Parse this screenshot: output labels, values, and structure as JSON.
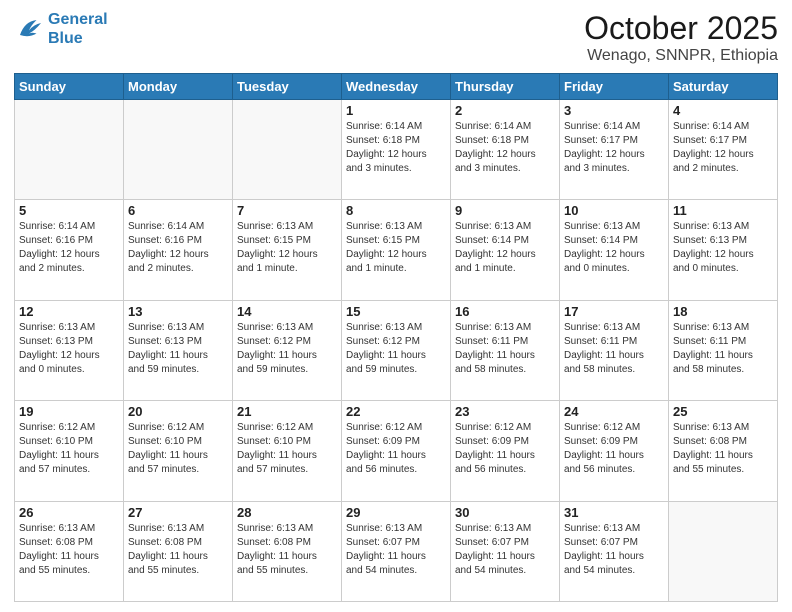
{
  "header": {
    "logo_line1": "General",
    "logo_line2": "Blue",
    "title": "October 2025",
    "subtitle": "Wenago, SNNPR, Ethiopia"
  },
  "days_of_week": [
    "Sunday",
    "Monday",
    "Tuesday",
    "Wednesday",
    "Thursday",
    "Friday",
    "Saturday"
  ],
  "weeks": [
    [
      {
        "day": "",
        "info": ""
      },
      {
        "day": "",
        "info": ""
      },
      {
        "day": "",
        "info": ""
      },
      {
        "day": "1",
        "info": "Sunrise: 6:14 AM\nSunset: 6:18 PM\nDaylight: 12 hours\nand 3 minutes."
      },
      {
        "day": "2",
        "info": "Sunrise: 6:14 AM\nSunset: 6:18 PM\nDaylight: 12 hours\nand 3 minutes."
      },
      {
        "day": "3",
        "info": "Sunrise: 6:14 AM\nSunset: 6:17 PM\nDaylight: 12 hours\nand 3 minutes."
      },
      {
        "day": "4",
        "info": "Sunrise: 6:14 AM\nSunset: 6:17 PM\nDaylight: 12 hours\nand 2 minutes."
      }
    ],
    [
      {
        "day": "5",
        "info": "Sunrise: 6:14 AM\nSunset: 6:16 PM\nDaylight: 12 hours\nand 2 minutes."
      },
      {
        "day": "6",
        "info": "Sunrise: 6:14 AM\nSunset: 6:16 PM\nDaylight: 12 hours\nand 2 minutes."
      },
      {
        "day": "7",
        "info": "Sunrise: 6:13 AM\nSunset: 6:15 PM\nDaylight: 12 hours\nand 1 minute."
      },
      {
        "day": "8",
        "info": "Sunrise: 6:13 AM\nSunset: 6:15 PM\nDaylight: 12 hours\nand 1 minute."
      },
      {
        "day": "9",
        "info": "Sunrise: 6:13 AM\nSunset: 6:14 PM\nDaylight: 12 hours\nand 1 minute."
      },
      {
        "day": "10",
        "info": "Sunrise: 6:13 AM\nSunset: 6:14 PM\nDaylight: 12 hours\nand 0 minutes."
      },
      {
        "day": "11",
        "info": "Sunrise: 6:13 AM\nSunset: 6:13 PM\nDaylight: 12 hours\nand 0 minutes."
      }
    ],
    [
      {
        "day": "12",
        "info": "Sunrise: 6:13 AM\nSunset: 6:13 PM\nDaylight: 12 hours\nand 0 minutes."
      },
      {
        "day": "13",
        "info": "Sunrise: 6:13 AM\nSunset: 6:13 PM\nDaylight: 11 hours\nand 59 minutes."
      },
      {
        "day": "14",
        "info": "Sunrise: 6:13 AM\nSunset: 6:12 PM\nDaylight: 11 hours\nand 59 minutes."
      },
      {
        "day": "15",
        "info": "Sunrise: 6:13 AM\nSunset: 6:12 PM\nDaylight: 11 hours\nand 59 minutes."
      },
      {
        "day": "16",
        "info": "Sunrise: 6:13 AM\nSunset: 6:11 PM\nDaylight: 11 hours\nand 58 minutes."
      },
      {
        "day": "17",
        "info": "Sunrise: 6:13 AM\nSunset: 6:11 PM\nDaylight: 11 hours\nand 58 minutes."
      },
      {
        "day": "18",
        "info": "Sunrise: 6:13 AM\nSunset: 6:11 PM\nDaylight: 11 hours\nand 58 minutes."
      }
    ],
    [
      {
        "day": "19",
        "info": "Sunrise: 6:12 AM\nSunset: 6:10 PM\nDaylight: 11 hours\nand 57 minutes."
      },
      {
        "day": "20",
        "info": "Sunrise: 6:12 AM\nSunset: 6:10 PM\nDaylight: 11 hours\nand 57 minutes."
      },
      {
        "day": "21",
        "info": "Sunrise: 6:12 AM\nSunset: 6:10 PM\nDaylight: 11 hours\nand 57 minutes."
      },
      {
        "day": "22",
        "info": "Sunrise: 6:12 AM\nSunset: 6:09 PM\nDaylight: 11 hours\nand 56 minutes."
      },
      {
        "day": "23",
        "info": "Sunrise: 6:12 AM\nSunset: 6:09 PM\nDaylight: 11 hours\nand 56 minutes."
      },
      {
        "day": "24",
        "info": "Sunrise: 6:12 AM\nSunset: 6:09 PM\nDaylight: 11 hours\nand 56 minutes."
      },
      {
        "day": "25",
        "info": "Sunrise: 6:13 AM\nSunset: 6:08 PM\nDaylight: 11 hours\nand 55 minutes."
      }
    ],
    [
      {
        "day": "26",
        "info": "Sunrise: 6:13 AM\nSunset: 6:08 PM\nDaylight: 11 hours\nand 55 minutes."
      },
      {
        "day": "27",
        "info": "Sunrise: 6:13 AM\nSunset: 6:08 PM\nDaylight: 11 hours\nand 55 minutes."
      },
      {
        "day": "28",
        "info": "Sunrise: 6:13 AM\nSunset: 6:08 PM\nDaylight: 11 hours\nand 55 minutes."
      },
      {
        "day": "29",
        "info": "Sunrise: 6:13 AM\nSunset: 6:07 PM\nDaylight: 11 hours\nand 54 minutes."
      },
      {
        "day": "30",
        "info": "Sunrise: 6:13 AM\nSunset: 6:07 PM\nDaylight: 11 hours\nand 54 minutes."
      },
      {
        "day": "31",
        "info": "Sunrise: 6:13 AM\nSunset: 6:07 PM\nDaylight: 11 hours\nand 54 minutes."
      },
      {
        "day": "",
        "info": ""
      }
    ]
  ]
}
